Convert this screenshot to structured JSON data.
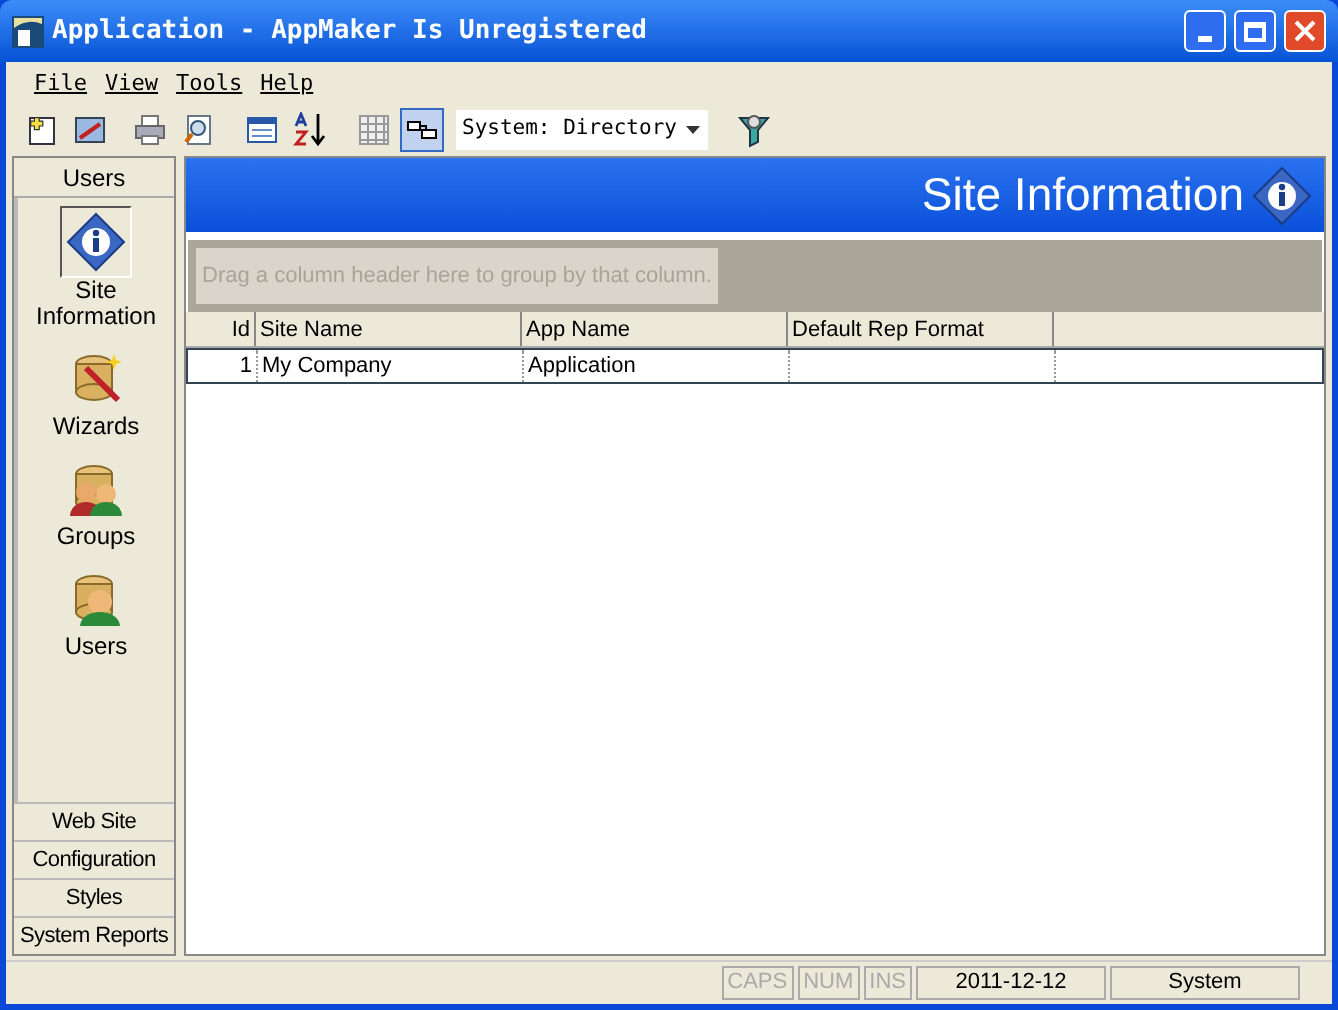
{
  "window": {
    "title": "Application - AppMaker Is Unregistered"
  },
  "menu": [
    "File",
    "View",
    "Tools",
    "Help"
  ],
  "toolbar": {
    "combo_value": "System: Directory"
  },
  "sidebar": {
    "open_group": "Users",
    "items": [
      {
        "label": "Site Information",
        "kind": "info",
        "selected": true
      },
      {
        "label": "Wizards",
        "kind": "wizard",
        "selected": false
      },
      {
        "label": "Groups",
        "kind": "groups",
        "selected": false
      },
      {
        "label": "Users",
        "kind": "user",
        "selected": false
      }
    ],
    "groups": [
      "Web Site",
      "Configuration",
      "Styles",
      "System Reports"
    ]
  },
  "banner": {
    "title": "Site Information"
  },
  "grid": {
    "group_hint": "Drag a column header here to group by that column.",
    "columns": [
      "Id",
      "Site Name",
      "App Name",
      "Default Rep Format"
    ],
    "rows": [
      {
        "cells": [
          "1",
          "My Company",
          "Application",
          ""
        ],
        "selected": true
      }
    ]
  },
  "status_bar": [
    {
      "text": "CAPS",
      "disabled": true
    },
    {
      "text": "NUM",
      "disabled": true
    },
    {
      "text": "INS",
      "disabled": true
    },
    {
      "text": "2011-12-12",
      "disabled": false
    },
    {
      "text": "System",
      "disabled": false
    }
  ]
}
